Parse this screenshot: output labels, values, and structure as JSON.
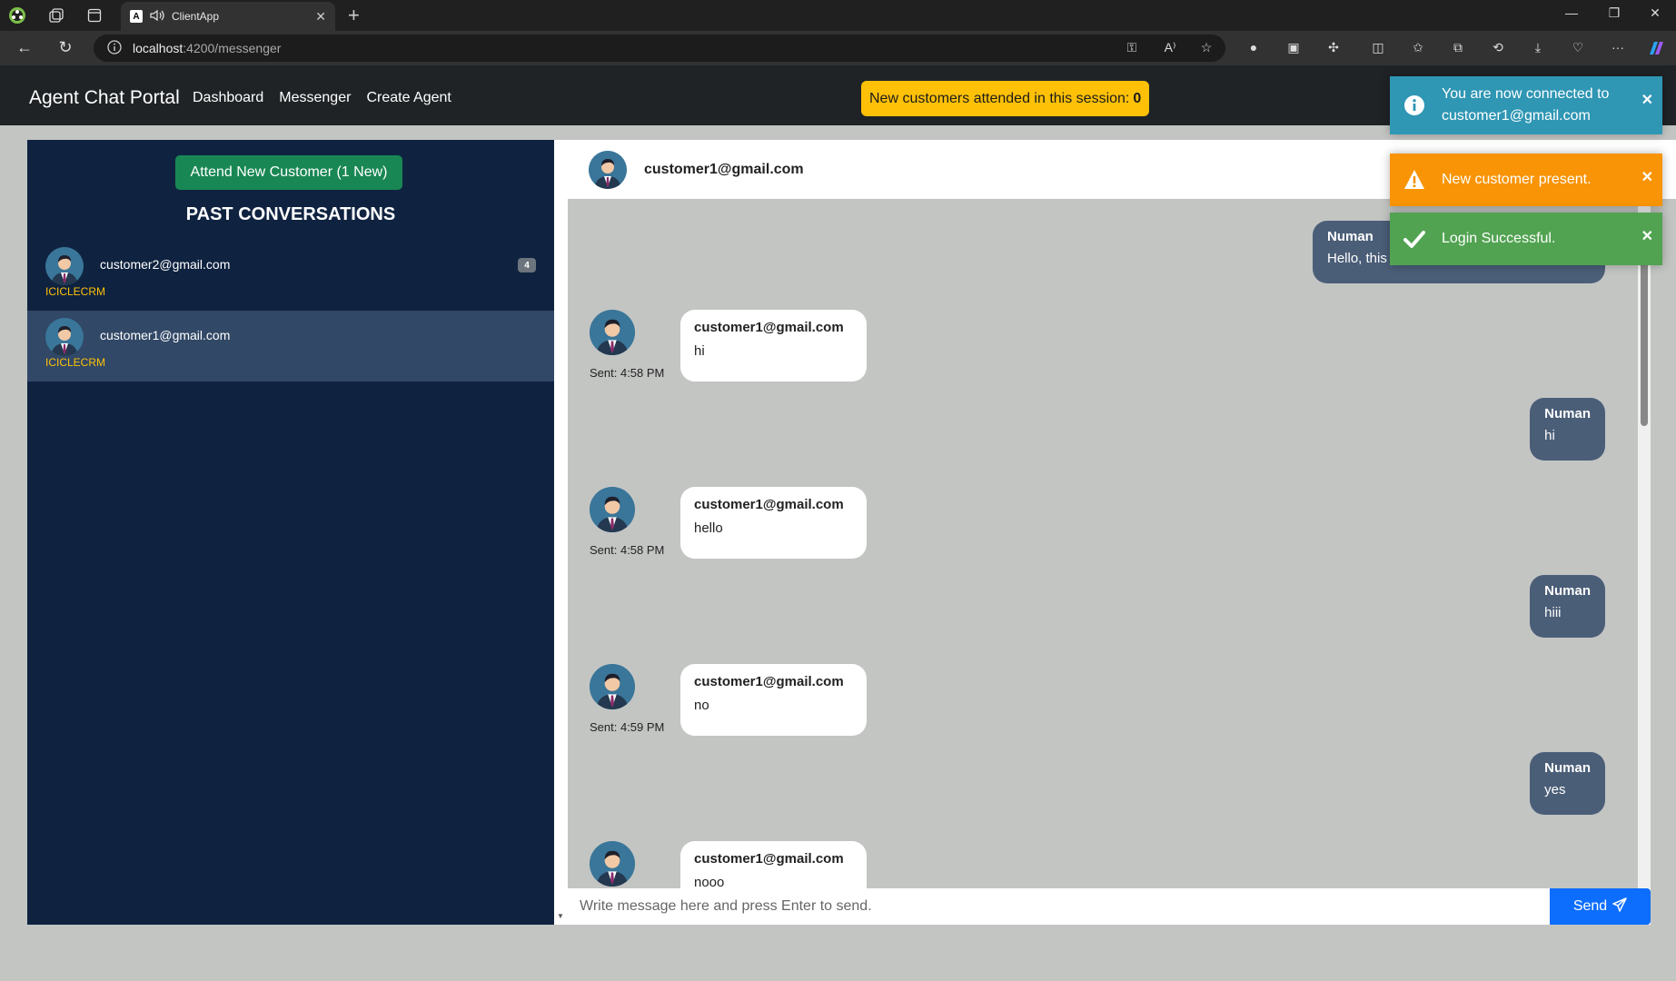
{
  "browser": {
    "tab_title": "ClientApp",
    "tab_favicon": "A",
    "url_host": "localhost",
    "url_path": ":4200/messenger"
  },
  "app": {
    "brand": "Agent Chat Portal",
    "nav": [
      "Dashboard",
      "Messenger",
      "Create Agent"
    ],
    "session_label": "New customers attended in this session:",
    "session_count": "0"
  },
  "sidebar": {
    "attend_button": "Attend New Customer (1 New)",
    "title": "PAST CONVERSATIONS",
    "conversations": [
      {
        "email": "customer2@gmail.com",
        "org": "ICICLECRM",
        "unread": "4"
      },
      {
        "email": "customer1@gmail.com",
        "org": "ICICLECRM",
        "unread": ""
      }
    ]
  },
  "chat": {
    "header_name": "customer1@gmail.com",
    "messages": [
      {
        "dir": "out",
        "sender": "Numan",
        "text": "Hello, this is Numan. How can I help you?"
      },
      {
        "dir": "in",
        "sender": "customer1@gmail.com",
        "text": "hi",
        "sent": "Sent: 4:58 PM"
      },
      {
        "dir": "out",
        "sender": "Numan",
        "text": "hi"
      },
      {
        "dir": "in",
        "sender": "customer1@gmail.com",
        "text": "hello",
        "sent": "Sent: 4:58 PM"
      },
      {
        "dir": "out",
        "sender": "Numan",
        "text": "hiii"
      },
      {
        "dir": "in",
        "sender": "customer1@gmail.com",
        "text": "no",
        "sent": "Sent: 4:59 PM"
      },
      {
        "dir": "out",
        "sender": "Numan",
        "text": "yes"
      },
      {
        "dir": "in",
        "sender": "customer1@gmail.com",
        "text": "nooo",
        "sent": ""
      }
    ],
    "input_placeholder": "Write message here and press Enter to send.",
    "send_label": "Send"
  },
  "toasts": [
    {
      "type": "info",
      "text": "You are now connected to customer1@gmail.com",
      "color": "#2f96b4"
    },
    {
      "type": "warning",
      "text": "New customer present.",
      "color": "#f89406"
    },
    {
      "type": "success",
      "text": "Login Successful.",
      "color": "#51a351"
    }
  ]
}
